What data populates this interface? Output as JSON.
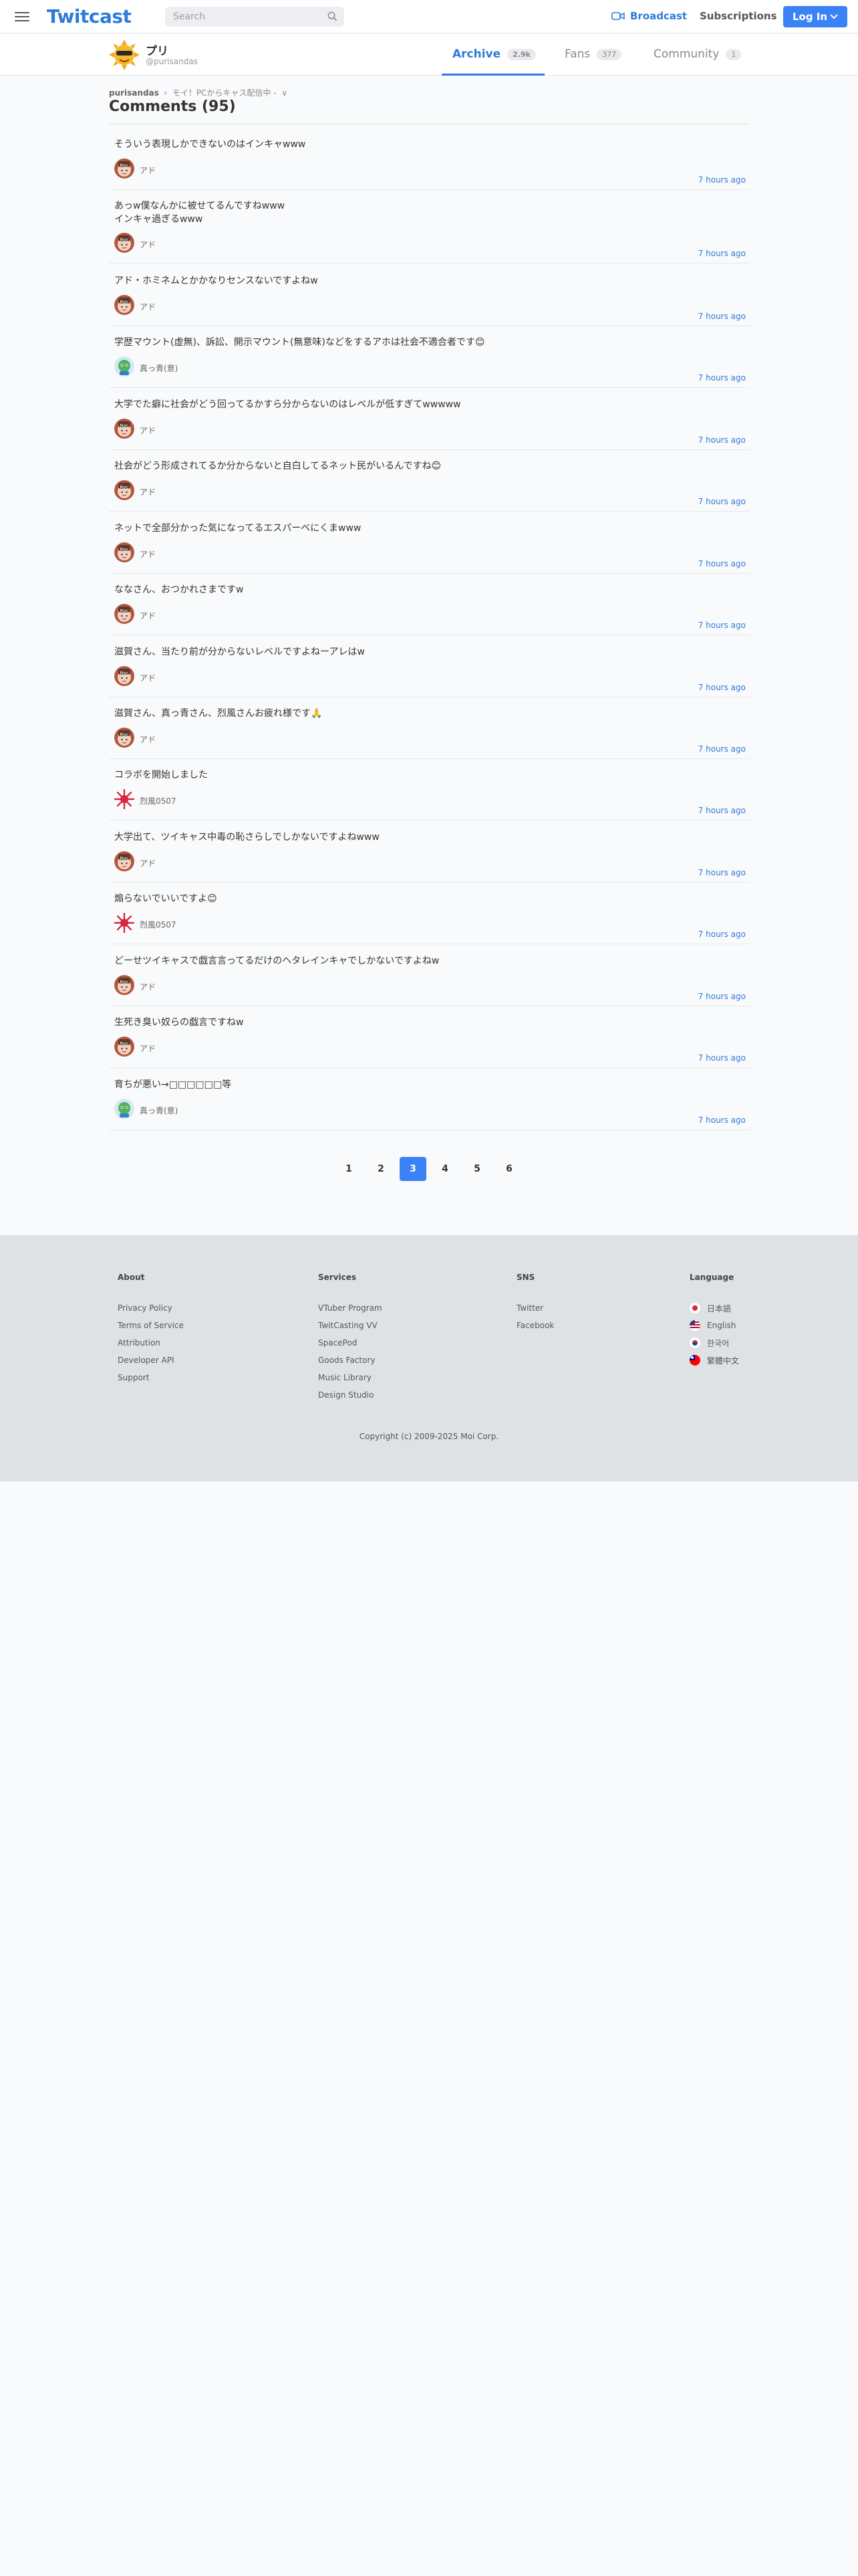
{
  "header": {
    "logo": "Twitcast",
    "search_placeholder": "Search",
    "broadcast_label": "Broadcast",
    "subscriptions_label": "Subscriptions",
    "login_label": "Log In"
  },
  "profile": {
    "name": "プリ",
    "handle": "@purisandas",
    "tabs": [
      {
        "label": "Archive",
        "count": "2.9k",
        "active": true
      },
      {
        "label": "Fans",
        "count": "377",
        "active": false
      },
      {
        "label": "Community",
        "count": "1",
        "active": false
      }
    ]
  },
  "breadcrumb": {
    "user": "purisandas",
    "separator": "›",
    "current": "モイ！PCからキャス配信中 -",
    "dropdown": "∨"
  },
  "page_title": "Comments (95)",
  "comments": [
    {
      "text": "そういう表現しかできないのはインキャwww",
      "user": "アド",
      "avatar": "ado",
      "time": "7 hours ago"
    },
    {
      "text": "あっw僕なんかに被せてるんですねwww\nインキャ過ぎるwww",
      "user": "アド",
      "avatar": "ado",
      "time": "7 hours ago"
    },
    {
      "text": "アド・ホミネムとかかなりセンスないですよねw",
      "user": "アド",
      "avatar": "ado",
      "time": "7 hours ago"
    },
    {
      "text": "学歴マウント(虚無)、訴訟、開示マウント(無意味)などをするアホは社会不適合者です😊",
      "user": "真っ青(意)",
      "avatar": "green",
      "time": "7 hours ago"
    },
    {
      "text": "大学でた癖に社会がどう回ってるかすら分からないのはレベルが低すぎてwwwww",
      "user": "アド",
      "avatar": "ado",
      "time": "7 hours ago"
    },
    {
      "text": "社会がどう形成されてるか分からないと自白してるネット民がいるんですね😊",
      "user": "アド",
      "avatar": "ado",
      "time": "7 hours ago"
    },
    {
      "text": "ネットで全部分かった気になってるエスパーベにくまwww",
      "user": "アド",
      "avatar": "ado",
      "time": "7 hours ago"
    },
    {
      "text": "ななさん、おつかれさまですw",
      "user": "アド",
      "avatar": "ado",
      "time": "7 hours ago"
    },
    {
      "text": "滋賀さん、当たり前が分からないレベルですよねーアレはw",
      "user": "アド",
      "avatar": "ado",
      "time": "7 hours ago"
    },
    {
      "text": "滋賀さん、真っ青さん、烈風さんお疲れ様です🙏",
      "user": "アド",
      "avatar": "ado",
      "time": "7 hours ago"
    },
    {
      "text": "コラボを開始しました",
      "user": "烈風0507",
      "avatar": "red",
      "time": "7 hours ago"
    },
    {
      "text": "大学出て、ツイキャス中毒の恥さらしでしかないですよねwww",
      "user": "アド",
      "avatar": "ado",
      "time": "7 hours ago"
    },
    {
      "text": "煽らないでいいですよ😊",
      "user": "烈風0507",
      "avatar": "red",
      "time": "7 hours ago"
    },
    {
      "text": "どーせツイキャスで戯言言ってるだけのヘタレインキャでしかないですよねw",
      "user": "アド",
      "avatar": "ado",
      "time": "7 hours ago"
    },
    {
      "text": "生死き臭い奴らの戯言ですねw",
      "user": "アド",
      "avatar": "ado",
      "time": "7 hours ago"
    },
    {
      "text": "育ちが悪い→□□□□□□等",
      "user": "真っ青(意)",
      "avatar": "green",
      "time": "7 hours ago"
    }
  ],
  "pagination": {
    "pages": [
      "1",
      "2",
      "3",
      "4",
      "5",
      "6"
    ],
    "current": "3"
  },
  "footer": {
    "columns": [
      {
        "title": "About",
        "links": [
          "Privacy Policy",
          "Terms of Service",
          "Attribution",
          "Developer API",
          "Support"
        ]
      },
      {
        "title": "Services",
        "links": [
          "VTuber Program",
          "TwitCasting VV",
          "SpacePod",
          "Goods Factory",
          "Music Library",
          "Design Studio"
        ]
      },
      {
        "title": "SNS",
        "links": [
          "Twitter",
          "Facebook"
        ]
      },
      {
        "title": "Language",
        "links": [
          "日本語",
          "English",
          "한국어",
          "繁體中文"
        ]
      }
    ],
    "copyright": "Copyright (c) 2009-2025 Moi Corp."
  },
  "colors": {
    "brand": "#2f7bda",
    "button": "#3b82f6",
    "footer_bg": "#dfe2e5"
  }
}
